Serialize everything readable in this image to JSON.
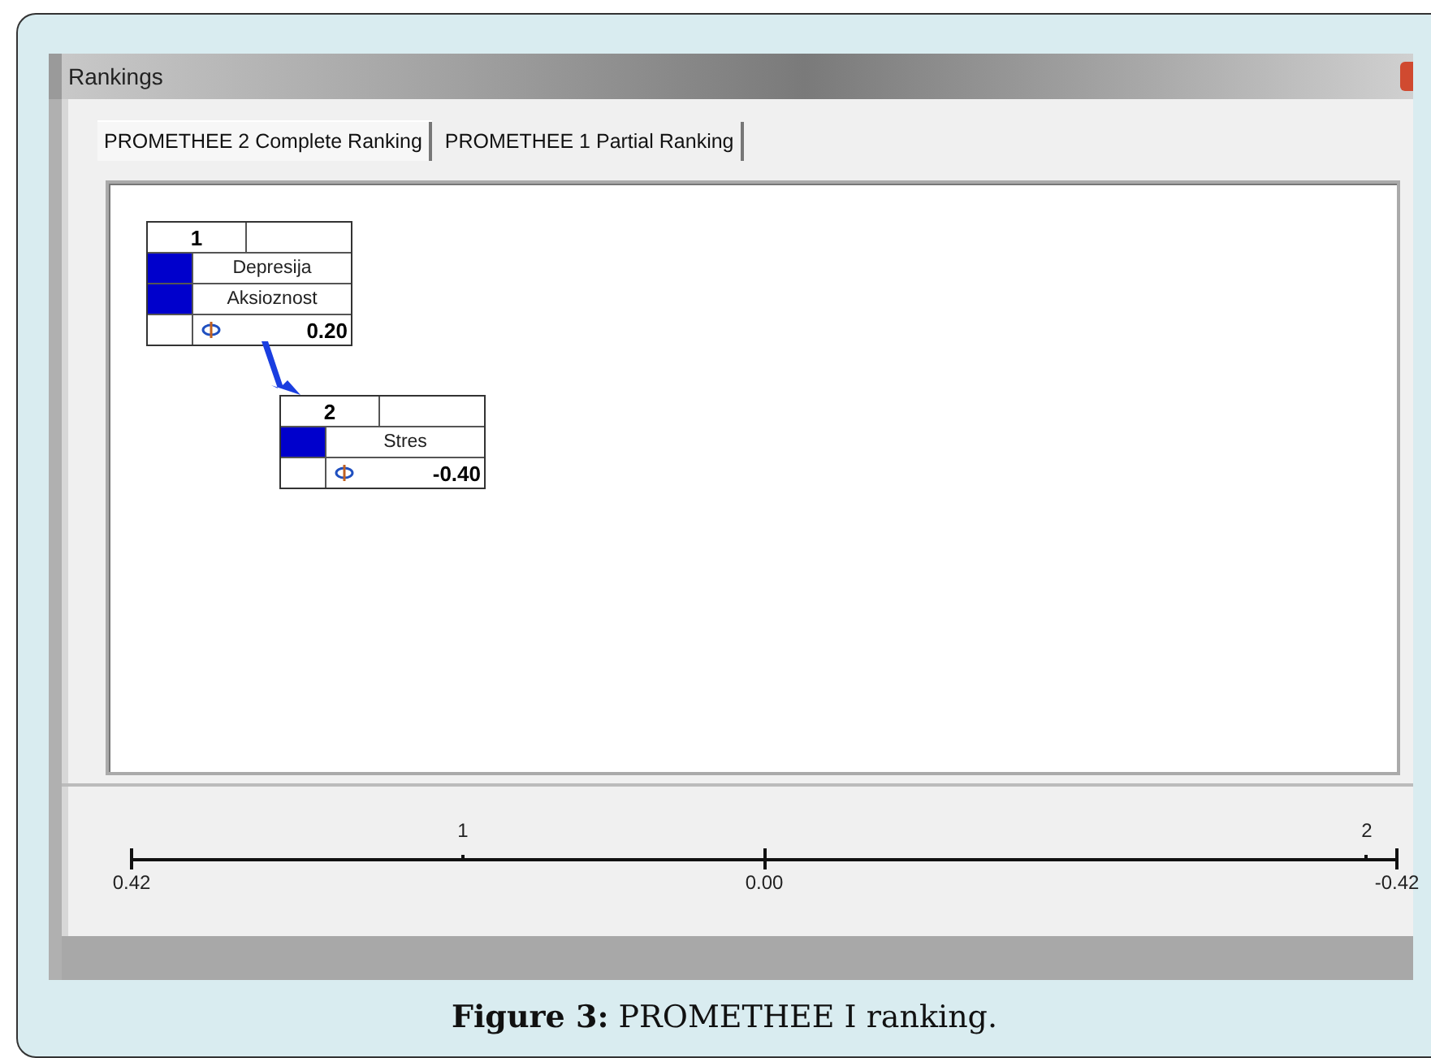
{
  "window": {
    "title": "Rankings"
  },
  "tabs": [
    {
      "label": "PROMETHEE 2 Complete Ranking",
      "selected": true
    },
    {
      "label": "PROMETHEE 1 Partial Ranking",
      "selected": false
    }
  ],
  "ranks": [
    {
      "rank": "1",
      "alternatives": [
        {
          "name": "Depresija",
          "color": "#0000cc"
        },
        {
          "name": "Aksioznost",
          "color": "#0000cc"
        }
      ],
      "phi": "0.20"
    },
    {
      "rank": "2",
      "alternatives": [
        {
          "name": "Stres",
          "color": "#0000cc"
        }
      ],
      "phi": "-0.40"
    }
  ],
  "scale": {
    "ticks": [
      "0.42",
      "0.00",
      "-0.42"
    ],
    "markers": [
      "1",
      "2"
    ]
  },
  "caption": "**Figure 3:** PROMETHEE I ranking."
}
